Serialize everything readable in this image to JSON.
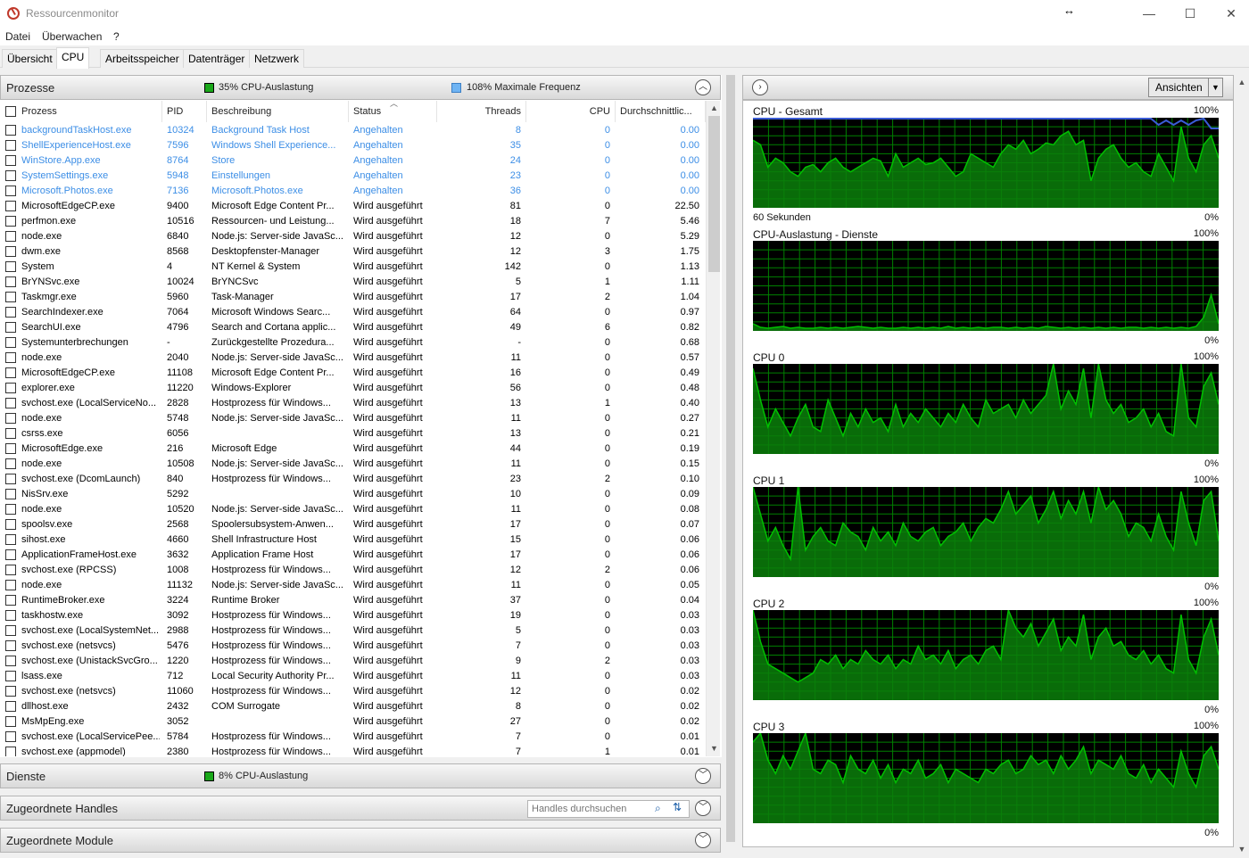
{
  "window": {
    "title": "Ressourcenmonitor",
    "minimize_glyph": "—",
    "maximize_glyph": "☐",
    "close_glyph": "✕"
  },
  "menu": [
    "Datei",
    "Überwachen",
    "?"
  ],
  "tabs": [
    "Übersicht",
    "CPU",
    "Arbeitsspeicher",
    "Datenträger",
    "Netzwerk"
  ],
  "active_tab": "CPU",
  "colors": {
    "graph_green": "#00c000",
    "graph_fill": "#0a7f0a",
    "graph_grid": "#008000",
    "frequency_line": "#3b5cd6",
    "suspended_text": "#3c8ee6"
  },
  "processes": {
    "title": "Prozesse",
    "cpu_stat": "35% CPU-Auslastung",
    "freq_stat": "108% Maximale Frequenz",
    "columns": [
      "Prozess",
      "PID",
      "Beschreibung",
      "Status",
      "Threads",
      "CPU",
      "Durchschnittlic..."
    ],
    "rows": [
      [
        "backgroundTaskHost.exe",
        "10324",
        "Background Task Host",
        "Angehalten",
        "8",
        "0",
        "0.00"
      ],
      [
        "ShellExperienceHost.exe",
        "7596",
        "Windows Shell Experience...",
        "Angehalten",
        "35",
        "0",
        "0.00"
      ],
      [
        "WinStore.App.exe",
        "8764",
        "Store",
        "Angehalten",
        "24",
        "0",
        "0.00"
      ],
      [
        "SystemSettings.exe",
        "5948",
        "Einstellungen",
        "Angehalten",
        "23",
        "0",
        "0.00"
      ],
      [
        "Microsoft.Photos.exe",
        "7136",
        "Microsoft.Photos.exe",
        "Angehalten",
        "36",
        "0",
        "0.00"
      ],
      [
        "MicrosoftEdgeCP.exe",
        "9400",
        "Microsoft Edge Content Pr...",
        "Wird ausgeführt",
        "81",
        "0",
        "22.50"
      ],
      [
        "perfmon.exe",
        "10516",
        "Ressourcen- und Leistung...",
        "Wird ausgeführt",
        "18",
        "7",
        "5.46"
      ],
      [
        "node.exe",
        "6840",
        "Node.js: Server-side JavaSc...",
        "Wird ausgeführt",
        "12",
        "0",
        "5.29"
      ],
      [
        "dwm.exe",
        "8568",
        "Desktopfenster-Manager",
        "Wird ausgeführt",
        "12",
        "3",
        "1.75"
      ],
      [
        "System",
        "4",
        "NT Kernel & System",
        "Wird ausgeführt",
        "142",
        "0",
        "1.13"
      ],
      [
        "BrYNSvc.exe",
        "10024",
        "BrYNCSvc",
        "Wird ausgeführt",
        "5",
        "1",
        "1.11"
      ],
      [
        "Taskmgr.exe",
        "5960",
        "Task-Manager",
        "Wird ausgeführt",
        "17",
        "2",
        "1.04"
      ],
      [
        "SearchIndexer.exe",
        "7064",
        "Microsoft Windows Searc...",
        "Wird ausgeführt",
        "64",
        "0",
        "0.97"
      ],
      [
        "SearchUI.exe",
        "4796",
        "Search and Cortana applic...",
        "Wird ausgeführt",
        "49",
        "6",
        "0.82"
      ],
      [
        "Systemunterbrechungen",
        "-",
        "Zurückgestellte Prozedura...",
        "Wird ausgeführt",
        "-",
        "0",
        "0.68"
      ],
      [
        "node.exe",
        "2040",
        "Node.js: Server-side JavaSc...",
        "Wird ausgeführt",
        "11",
        "0",
        "0.57"
      ],
      [
        "MicrosoftEdgeCP.exe",
        "11108",
        "Microsoft Edge Content Pr...",
        "Wird ausgeführt",
        "16",
        "0",
        "0.49"
      ],
      [
        "explorer.exe",
        "11220",
        "Windows-Explorer",
        "Wird ausgeführt",
        "56",
        "0",
        "0.48"
      ],
      [
        "svchost.exe (LocalServiceNo...",
        "2828",
        "Hostprozess für Windows...",
        "Wird ausgeführt",
        "13",
        "1",
        "0.40"
      ],
      [
        "node.exe",
        "5748",
        "Node.js: Server-side JavaSc...",
        "Wird ausgeführt",
        "11",
        "0",
        "0.27"
      ],
      [
        "csrss.exe",
        "6056",
        "",
        "Wird ausgeführt",
        "13",
        "0",
        "0.21"
      ],
      [
        "MicrosoftEdge.exe",
        "216",
        "Microsoft Edge",
        "Wird ausgeführt",
        "44",
        "0",
        "0.19"
      ],
      [
        "node.exe",
        "10508",
        "Node.js: Server-side JavaSc...",
        "Wird ausgeführt",
        "11",
        "0",
        "0.15"
      ],
      [
        "svchost.exe (DcomLaunch)",
        "840",
        "Hostprozess für Windows...",
        "Wird ausgeführt",
        "23",
        "2",
        "0.10"
      ],
      [
        "NisSrv.exe",
        "5292",
        "",
        "Wird ausgeführt",
        "10",
        "0",
        "0.09"
      ],
      [
        "node.exe",
        "10520",
        "Node.js: Server-side JavaSc...",
        "Wird ausgeführt",
        "11",
        "0",
        "0.08"
      ],
      [
        "spoolsv.exe",
        "2568",
        "Spoolersubsystem-Anwen...",
        "Wird ausgeführt",
        "17",
        "0",
        "0.07"
      ],
      [
        "sihost.exe",
        "4660",
        "Shell Infrastructure Host",
        "Wird ausgeführt",
        "15",
        "0",
        "0.06"
      ],
      [
        "ApplicationFrameHost.exe",
        "3632",
        "Application Frame Host",
        "Wird ausgeführt",
        "17",
        "0",
        "0.06"
      ],
      [
        "svchost.exe (RPCSS)",
        "1008",
        "Hostprozess für Windows...",
        "Wird ausgeführt",
        "12",
        "2",
        "0.06"
      ],
      [
        "node.exe",
        "11132",
        "Node.js: Server-side JavaSc...",
        "Wird ausgeführt",
        "11",
        "0",
        "0.05"
      ],
      [
        "RuntimeBroker.exe",
        "3224",
        "Runtime Broker",
        "Wird ausgeführt",
        "37",
        "0",
        "0.04"
      ],
      [
        "taskhostw.exe",
        "3092",
        "Hostprozess für Windows...",
        "Wird ausgeführt",
        "19",
        "0",
        "0.03"
      ],
      [
        "svchost.exe (LocalSystemNet...",
        "2988",
        "Hostprozess für Windows...",
        "Wird ausgeführt",
        "5",
        "0",
        "0.03"
      ],
      [
        "svchost.exe (netsvcs)",
        "5476",
        "Hostprozess für Windows...",
        "Wird ausgeführt",
        "7",
        "0",
        "0.03"
      ],
      [
        "svchost.exe (UnistackSvcGro...",
        "1220",
        "Hostprozess für Windows...",
        "Wird ausgeführt",
        "9",
        "2",
        "0.03"
      ],
      [
        "lsass.exe",
        "712",
        "Local Security Authority Pr...",
        "Wird ausgeführt",
        "11",
        "0",
        "0.03"
      ],
      [
        "svchost.exe (netsvcs)",
        "11060",
        "Hostprozess für Windows...",
        "Wird ausgeführt",
        "12",
        "0",
        "0.02"
      ],
      [
        "dllhost.exe",
        "2432",
        "COM Surrogate",
        "Wird ausgeführt",
        "8",
        "0",
        "0.02"
      ],
      [
        "MsMpEng.exe",
        "3052",
        "",
        "Wird ausgeführt",
        "27",
        "0",
        "0.02"
      ],
      [
        "svchost.exe (LocalServicePee...",
        "5784",
        "Hostprozess für Windows...",
        "Wird ausgeführt",
        "7",
        "0",
        "0.01"
      ],
      [
        "svchost.exe (appmodel)",
        "2380",
        "Hostprozess für Windows...",
        "Wird ausgeführt",
        "7",
        "1",
        "0.01"
      ]
    ]
  },
  "services": {
    "title": "Dienste",
    "cpu_stat": "8% CPU-Auslastung"
  },
  "handles": {
    "title": "Zugeordnete Handles",
    "search_placeholder": "Handles durchsuchen"
  },
  "modules": {
    "title": "Zugeordnete Module"
  },
  "right_panel": {
    "view_button": "Ansichten"
  },
  "graphs": [
    {
      "title": "CPU - Gesamt",
      "max": "100%",
      "min": "0%",
      "sub": "60 Sekunden",
      "values": [
        75,
        70,
        45,
        55,
        50,
        40,
        35,
        45,
        48,
        40,
        50,
        55,
        45,
        40,
        45,
        50,
        55,
        52,
        35,
        60,
        45,
        50,
        55,
        48,
        50,
        55,
        45,
        35,
        40,
        60,
        55,
        50,
        45,
        60,
        70,
        65,
        75,
        60,
        65,
        72,
        70,
        80,
        85,
        70,
        75,
        30,
        55,
        65,
        70,
        55,
        45,
        50,
        40,
        35,
        60,
        45,
        30,
        90,
        55,
        40,
        70,
        80,
        55
      ]
    },
    {
      "title": "CPU-Auslastung - Dienste",
      "max": "100%",
      "min": "0%",
      "sub": "",
      "values": [
        8,
        4,
        3,
        4,
        5,
        3,
        4,
        3,
        3,
        4,
        3,
        4,
        3,
        4,
        5,
        4,
        3,
        4,
        3,
        3,
        4,
        3,
        4,
        3,
        4,
        3,
        5,
        3,
        4,
        3,
        4,
        3,
        4,
        4,
        3,
        4,
        3,
        4,
        3,
        5,
        4,
        3,
        4,
        3,
        4,
        3,
        4,
        3,
        4,
        3,
        4,
        4,
        3,
        4,
        3,
        4,
        3,
        4,
        3,
        5,
        15,
        40,
        8
      ]
    },
    {
      "title": "CPU 0",
      "max": "100%",
      "min": "0%",
      "sub": "",
      "values": [
        95,
        60,
        30,
        50,
        35,
        20,
        40,
        55,
        30,
        25,
        60,
        40,
        20,
        45,
        30,
        50,
        35,
        40,
        25,
        55,
        30,
        45,
        35,
        50,
        40,
        30,
        45,
        35,
        55,
        40,
        30,
        60,
        45,
        50,
        55,
        40,
        60,
        45,
        55,
        65,
        100,
        50,
        70,
        55,
        95,
        40,
        100,
        60,
        45,
        55,
        35,
        40,
        50,
        30,
        45,
        25,
        20,
        100,
        40,
        30,
        75,
        90,
        55
      ]
    },
    {
      "title": "CPU 1",
      "max": "100%",
      "min": "0%",
      "sub": "",
      "values": [
        100,
        70,
        40,
        55,
        35,
        20,
        100,
        30,
        45,
        55,
        40,
        35,
        60,
        50,
        45,
        30,
        55,
        40,
        50,
        35,
        60,
        45,
        40,
        50,
        55,
        35,
        45,
        50,
        60,
        40,
        55,
        65,
        60,
        75,
        95,
        70,
        80,
        90,
        60,
        75,
        95,
        65,
        85,
        70,
        95,
        60,
        100,
        75,
        85,
        70,
        45,
        60,
        55,
        40,
        70,
        45,
        30,
        95,
        60,
        35,
        85,
        95,
        40
      ]
    },
    {
      "title": "CPU 2",
      "max": "100%",
      "min": "0%",
      "sub": "",
      "values": [
        100,
        65,
        40,
        35,
        30,
        25,
        20,
        25,
        30,
        45,
        40,
        50,
        35,
        45,
        40,
        55,
        45,
        40,
        50,
        35,
        45,
        40,
        60,
        45,
        50,
        40,
        55,
        35,
        45,
        50,
        40,
        55,
        60,
        45,
        100,
        80,
        70,
        85,
        60,
        75,
        90,
        55,
        70,
        60,
        95,
        45,
        70,
        80,
        60,
        65,
        50,
        45,
        55,
        40,
        50,
        35,
        30,
        95,
        45,
        30,
        70,
        90,
        50
      ]
    },
    {
      "title": "CPU 3",
      "max": "100%",
      "min": "0%",
      "sub": "",
      "values": [
        90,
        100,
        70,
        55,
        75,
        60,
        80,
        100,
        60,
        55,
        70,
        65,
        45,
        75,
        60,
        55,
        70,
        50,
        65,
        45,
        60,
        55,
        70,
        50,
        55,
        65,
        45,
        60,
        55,
        50,
        45,
        60,
        55,
        65,
        70,
        55,
        60,
        75,
        65,
        70,
        55,
        75,
        60,
        70,
        85,
        55,
        70,
        65,
        60,
        75,
        55,
        50,
        65,
        45,
        60,
        50,
        40,
        80,
        55,
        40,
        75,
        85,
        60
      ]
    }
  ]
}
